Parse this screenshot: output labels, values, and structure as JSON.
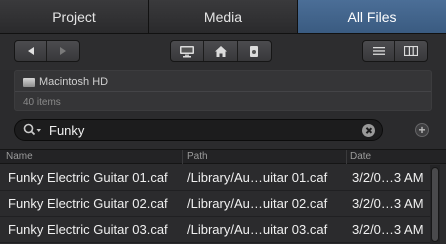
{
  "tabs": [
    {
      "label": "Project"
    },
    {
      "label": "Media"
    },
    {
      "label": "All Files"
    }
  ],
  "location": {
    "name": "Macintosh HD",
    "count": "40 items"
  },
  "search": {
    "query": "Funky"
  },
  "table": {
    "headers": {
      "name": "Name",
      "path": "Path",
      "date": "Date"
    },
    "rows": [
      {
        "name": "Funky Electric Guitar 01.caf",
        "path": "/Library/Au…uitar 01.caf",
        "date": "3/2/0…3 AM"
      },
      {
        "name": "Funky Electric Guitar 02.caf",
        "path": "/Library/Au…uitar 02.caf",
        "date": "3/2/0…3 AM"
      },
      {
        "name": "Funky Electric Guitar 03.caf",
        "path": "/Library/Au…uitar 03.caf",
        "date": "3/2/0…3 AM"
      }
    ]
  },
  "icons": {
    "back": "chevron-left-icon",
    "forward": "chevron-right-icon",
    "computer": "monitor-icon",
    "home": "home-icon",
    "documents": "document-icon",
    "list_view": "list-view-icon",
    "column_view": "column-view-icon"
  },
  "colors": {
    "active_tab": "#4a6d96",
    "background": "#2b2b2d"
  }
}
